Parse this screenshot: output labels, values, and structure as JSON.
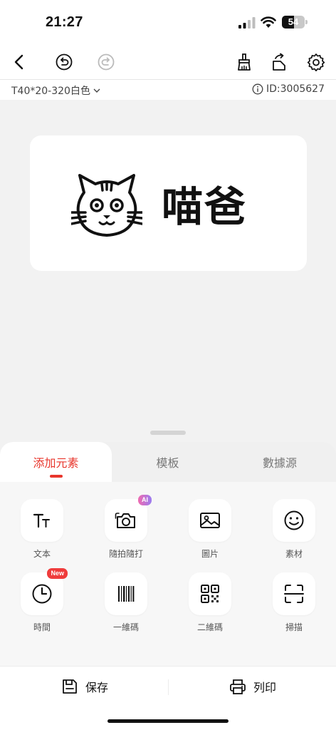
{
  "status": {
    "time": "21:27",
    "battery": "54",
    "battery_level": 0.54
  },
  "toolbar": {
    "back": "back-arrow-icon",
    "undo": "undo-icon",
    "redo": "redo-icon",
    "clear": "broom-icon",
    "rotate": "rotate-icon",
    "settings": "gear-icon"
  },
  "info": {
    "model": "T40*20-320白色",
    "id": "ID:3005627"
  },
  "label": {
    "text": "喵爸",
    "icon": "cat-face-icon"
  },
  "tabs": [
    {
      "label": "添加元素",
      "active": true
    },
    {
      "label": "模板",
      "active": false
    },
    {
      "label": "數據源",
      "active": false
    }
  ],
  "elements": [
    {
      "label": "文本",
      "icon": "text-icon"
    },
    {
      "label": "隨拍隨打",
      "icon": "camera-icon",
      "badge": "AI"
    },
    {
      "label": "圖片",
      "icon": "image-icon"
    },
    {
      "label": "素材",
      "icon": "smiley-icon"
    },
    {
      "label": "時間",
      "icon": "clock-icon",
      "badge": "New"
    },
    {
      "label": "一維碼",
      "icon": "barcode-icon"
    },
    {
      "label": "二維碼",
      "icon": "qr-code-icon"
    },
    {
      "label": "掃描",
      "icon": "scan-icon"
    }
  ],
  "pager": {
    "pages": 2,
    "current": 1
  },
  "footer": {
    "save": "保存",
    "print": "列印"
  },
  "colors": {
    "accent": "#e8362c",
    "ai_badge": "#b774e0",
    "new_badge": "#ef3b3b"
  }
}
